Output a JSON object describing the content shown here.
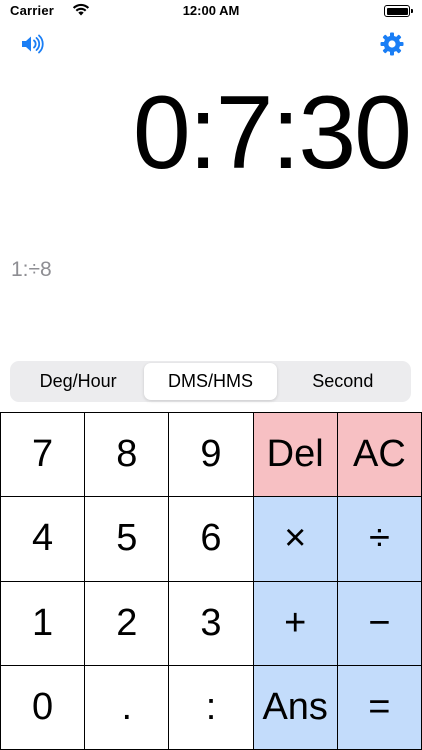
{
  "status_bar": {
    "carrier": "Carrier",
    "time": "12:00 AM"
  },
  "icons": {
    "sound": "speaker-icon",
    "settings": "gear-icon",
    "accent_color": "#1a7ef5"
  },
  "display": {
    "value": "0:7:30",
    "expression": "1:÷8"
  },
  "modes": {
    "items": [
      "Deg/Hour",
      "DMS/HMS",
      "Second"
    ],
    "selected": "DMS/HMS"
  },
  "keypad": {
    "colors": {
      "function": "#f7c0c3",
      "operator": "#c3dcfb",
      "digit": "#ffffff"
    },
    "rows": [
      [
        "7",
        "8",
        "9",
        "Del",
        "AC"
      ],
      [
        "4",
        "5",
        "6",
        "×",
        "÷"
      ],
      [
        "1",
        "2",
        "3",
        "+",
        "−"
      ],
      [
        "0",
        ".",
        ":",
        "Ans",
        "="
      ]
    ]
  }
}
